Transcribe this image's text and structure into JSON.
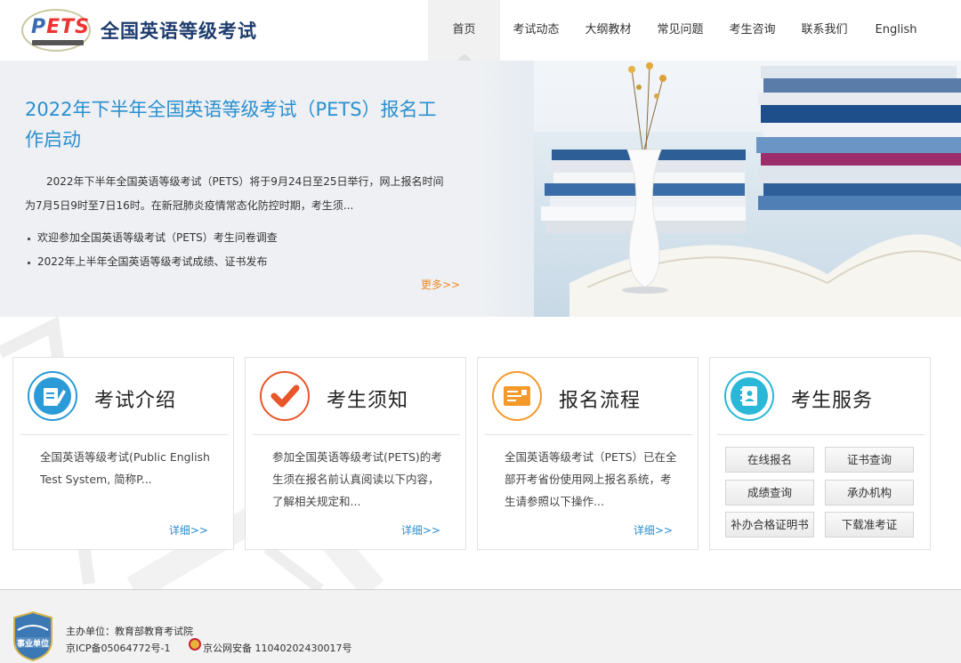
{
  "header": {
    "site_title": "全国英语等级考试",
    "logo_text": "PETS",
    "nav": [
      "首页",
      "考试动态",
      "大纲教材",
      "常见问题",
      "考生咨询",
      "联系我们",
      "English"
    ]
  },
  "banner": {
    "headline": "2022年下半年全国英语等级考试（PETS）报名工作启动",
    "lead": "2022年下半年全国英语等级考试（PETS）将于9月24日至25日举行，网上报名时间为7月5日9时至7日16时。在新冠肺炎疫情常态化防控时期，考生须...",
    "news": [
      "欢迎参加全国英语等级考试（PETS）考生问卷调查",
      "2022年上半年全国英语等级考试成绩、证书发布"
    ],
    "more": "更多>>"
  },
  "cards": [
    {
      "title": "考试介绍",
      "desc": "全国英语等级考试(Public English Test System, 简称P...",
      "detail": "详细>>",
      "icon": "document-pen-icon"
    },
    {
      "title": "考生须知",
      "desc": "参加全国英语等级考试(PETS)的考生须在报名前认真阅读以下内容，了解相关规定和...",
      "detail": "详细>>",
      "icon": "checkmark-icon"
    },
    {
      "title": "报名流程",
      "desc": "全国英语等级考试（PETS）已在全部开考省份使用网上报名系统，考生请参照以下操作...",
      "detail": "详细>>",
      "icon": "form-icon"
    },
    {
      "title": "考生服务",
      "icon": "contact-book-icon"
    }
  ],
  "services": [
    "在线报名",
    "证书查询",
    "成绩查询",
    "承办机构",
    "补办合格证明书",
    "下载准考证"
  ],
  "footer": {
    "sponsor": "主办单位：教育部教育考试院",
    "icp": "京ICP备05064772号-1",
    "police": "京公网安备 11040202430017号",
    "emblem_text": "事业单位"
  },
  "colors": {
    "accent": "#2a8fd0",
    "more": "#f08a24",
    "title": "#1e3c6e"
  }
}
